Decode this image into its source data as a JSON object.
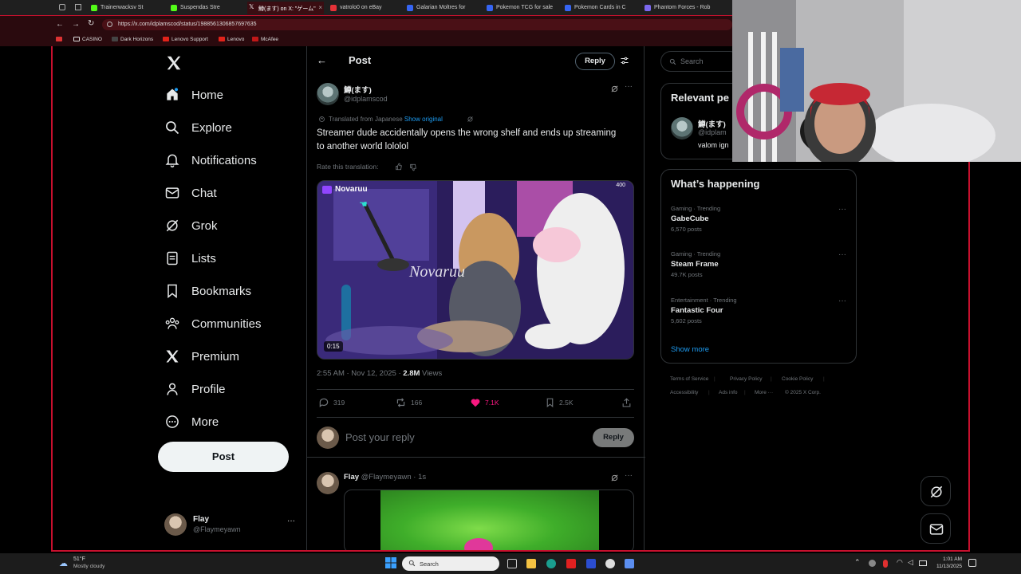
{
  "browser": {
    "tabs": [
      {
        "label": "Trainerwacksv St"
      },
      {
        "label": "Suspendas Stre"
      },
      {
        "label": "鱒(ます) on X: \"ゲーム\""
      },
      {
        "label": "vatrolo0 on eBay"
      },
      {
        "label": "Galarian Moltres for"
      },
      {
        "label": "Pokemon TCG for sale"
      },
      {
        "label": "Pokemon Cards in C"
      },
      {
        "label": "Phantom Forces - Rob"
      }
    ],
    "url": "https://x.com/idplamscod/status/1988561306857697635",
    "bookmarks": [
      "CASINO",
      "Dark Horizons",
      "Lenovo Support",
      "Lenovo",
      "McAfee"
    ]
  },
  "nav": {
    "items": [
      {
        "label": "Home",
        "icon": "home-icon"
      },
      {
        "label": "Explore",
        "icon": "search-icon"
      },
      {
        "label": "Notifications",
        "icon": "bell-icon"
      },
      {
        "label": "Chat",
        "icon": "mail-icon"
      },
      {
        "label": "Grok",
        "icon": "grok-icon"
      },
      {
        "label": "Lists",
        "icon": "list-icon"
      },
      {
        "label": "Bookmarks",
        "icon": "bookmark-icon"
      },
      {
        "label": "Communities",
        "icon": "communities-icon"
      },
      {
        "label": "Premium",
        "icon": "x-icon"
      },
      {
        "label": "Profile",
        "icon": "person-icon"
      },
      {
        "label": "More",
        "icon": "more-circle-icon"
      }
    ],
    "post_label": "Post",
    "account": {
      "name": "Flay",
      "handle": "@Flaymeyawn",
      "more": "···"
    }
  },
  "header": {
    "title": "Post",
    "reply_label": "Reply"
  },
  "post": {
    "author_name": "鱒(ます)",
    "author_handle": "@idplamscod",
    "translated_from": "Translated from Japanese",
    "show_original": "Show original",
    "text": "Streamer dude accidentally opens the wrong shelf and ends up streaming to another world lololol",
    "rate_translation": "Rate this translation:",
    "video": {
      "watermark": "Novaruu",
      "duration": "0:15",
      "badge": "400",
      "neon_text": "Novaruu"
    },
    "time": "2:55 AM · Nov 12, 2025",
    "views_count": "2.8M",
    "views_label": "Views",
    "stats": {
      "replies": "319",
      "reposts": "166",
      "likes": "7.1K",
      "bookmarks": "2.5K"
    }
  },
  "reply_box": {
    "placeholder": "Post your reply",
    "button": "Reply"
  },
  "reply": {
    "name": "Flay",
    "handle": "@Flaymeyawn",
    "time": "· 1s"
  },
  "right": {
    "search_placeholder": "Search",
    "relevant": {
      "title": "Relevant pe",
      "name": "鱒(ます)",
      "handle": "@idplam",
      "bio": "valom ign"
    },
    "happening": {
      "title": "What’s happening",
      "trends": [
        {
          "category": "Gaming · Trending",
          "name": "GabeCube",
          "posts": "6,570 posts"
        },
        {
          "category": "Gaming · Trending",
          "name": "Steam Frame",
          "posts": "49.7K posts"
        },
        {
          "category": "Entertainment · Trending",
          "name": "Fantastic Four",
          "posts": "5,602 posts"
        }
      ],
      "show_more": "Show more"
    },
    "footer": [
      "Terms of Service",
      "Privacy Policy",
      "Cookie Policy",
      "Accessibility",
      "Ads info",
      "More ···",
      "© 2025 X Corp."
    ]
  },
  "taskbar": {
    "weather_temp": "51°F",
    "weather_desc": "Mostly cloudy",
    "search_label": "Search",
    "time": "1:01 AM",
    "date": "11/13/2025"
  },
  "colors": {
    "accent": "#1d9bf0",
    "like": "#f91880",
    "brand_red": "#c8102e"
  }
}
